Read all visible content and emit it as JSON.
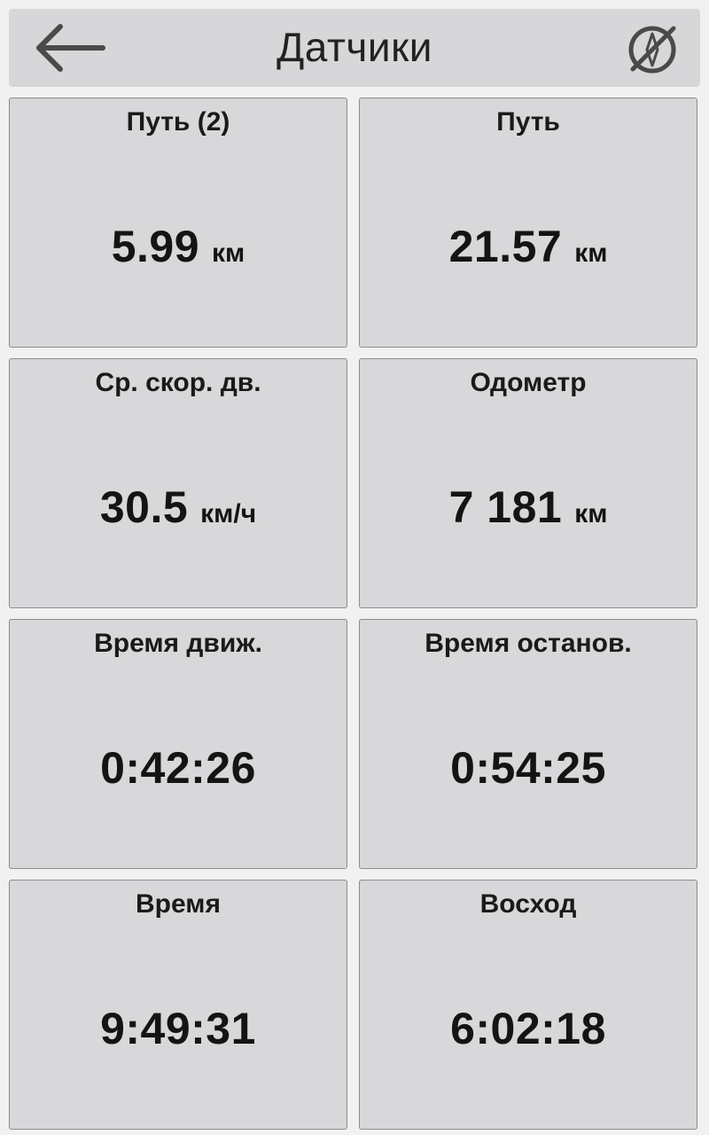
{
  "header": {
    "title": "Датчики",
    "back_icon": "arrow-left-icon",
    "right_icon": "compass-off-icon"
  },
  "tiles": [
    {
      "label": "Путь (2)",
      "value": "5.99",
      "unit": "км"
    },
    {
      "label": "Путь",
      "value": "21.57",
      "unit": "км"
    },
    {
      "label": "Ср. скор. дв.",
      "value": "30.5",
      "unit": "км/ч"
    },
    {
      "label": "Одометр",
      "value": "7 181",
      "unit": "км"
    },
    {
      "label": "Время движ.",
      "value": "0:42:26",
      "unit": ""
    },
    {
      "label": "Время останов.",
      "value": "0:54:25",
      "unit": ""
    },
    {
      "label": "Время",
      "value": "9:49:31",
      "unit": ""
    },
    {
      "label": "Восход",
      "value": "6:02:18",
      "unit": ""
    }
  ],
  "colors": {
    "background": "#f1f1f1",
    "panel": "#d8d7d9",
    "border": "#8c8c8e",
    "text": "#1a1a1a",
    "icon": "#4a4a4a"
  }
}
